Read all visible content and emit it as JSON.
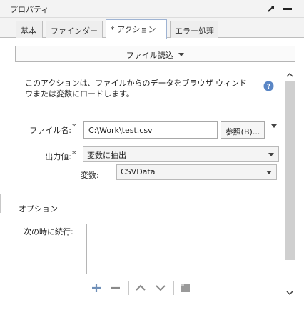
{
  "panel": {
    "title": "プロパティ"
  },
  "tabs": [
    {
      "label": "基本"
    },
    {
      "label": "ファインダー"
    },
    {
      "label": "* アクション"
    },
    {
      "label": "エラー処理"
    }
  ],
  "action_select": {
    "label": "ファイル読込"
  },
  "description": "このアクションは、ファイルからのデータをブラウザ ウィンドウまたは変数にロードします。",
  "form": {
    "filename_label": "ファイル名:",
    "filename_value": "C:\\Work\\test.csv",
    "browse_label": "参照(B)...",
    "output_label": "出力値:",
    "output_value": "変数に抽出",
    "variable_label": "変数:",
    "variable_value": "CSVData",
    "required_mark": "*"
  },
  "options": {
    "section_label": "オプション",
    "continue_label": "次の時に続行:"
  },
  "colors": {
    "help_icon": "#5a86c5",
    "active_tab_border": "#9eb3d3"
  }
}
